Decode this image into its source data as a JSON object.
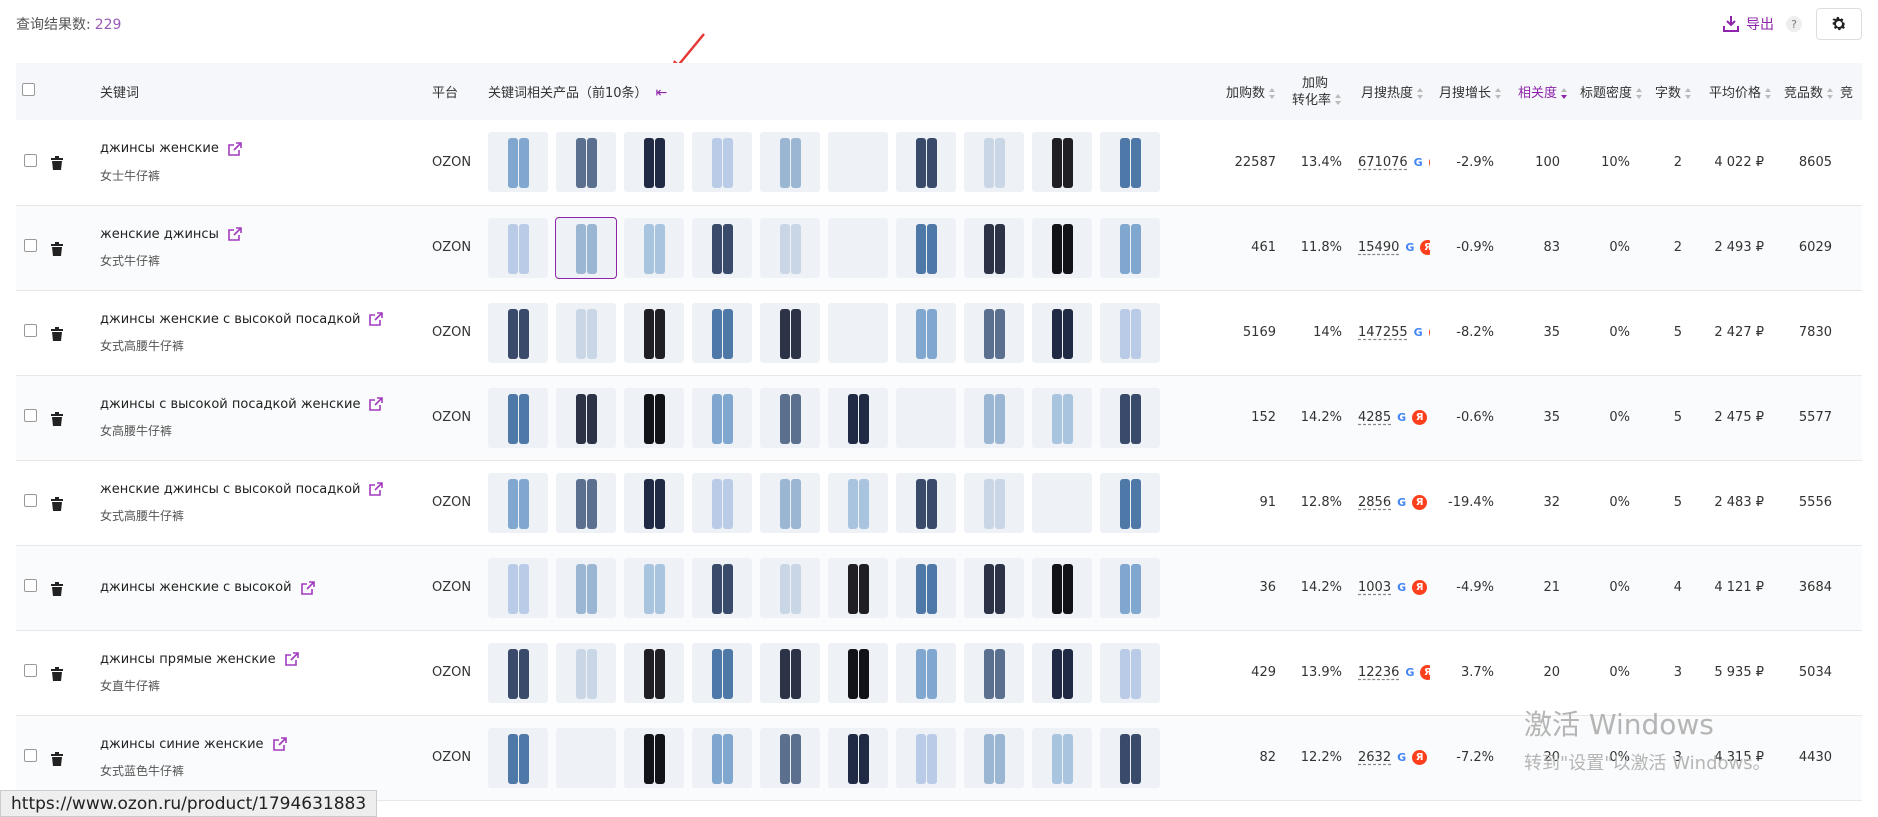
{
  "header": {
    "result_count_label": "查询结果数:",
    "result_count": "229",
    "export_label": "导出",
    "help": "?"
  },
  "columns": {
    "keyword": "关键词",
    "platform": "平台",
    "products": "关键词相关产品（前10条）",
    "cart_adds": "加购数",
    "cart_conv_line1": "加购",
    "cart_conv_line2": "转化率",
    "monthly_search": "月搜热度",
    "monthly_growth": "月搜增长",
    "relevance": "相关度",
    "title_density": "标题密度",
    "char_count": "字数",
    "avg_price": "平均价格",
    "competitors": "竞品数",
    "more": "竞"
  },
  "rows": [
    {
      "kw": "джинсы женские",
      "cn": "女士牛仔裤",
      "platform": "OZON",
      "cart": "22587",
      "conv": "13.4%",
      "search": "671076",
      "growth": "-2.9%",
      "rel": "100",
      "density": "10%",
      "chars": "2",
      "price": "4 022 ₽",
      "comp": "8605"
    },
    {
      "kw": "женские джинсы",
      "cn": "女式牛仔裤",
      "platform": "OZON",
      "cart": "461",
      "conv": "11.8%",
      "search": "15490",
      "growth": "-0.9%",
      "rel": "83",
      "density": "0%",
      "chars": "2",
      "price": "2 493 ₽",
      "comp": "6029"
    },
    {
      "kw": "джинсы женские с высокой посадкой",
      "cn": "女式高腰牛仔裤",
      "platform": "OZON",
      "cart": "5169",
      "conv": "14%",
      "search": "147255",
      "growth": "-8.2%",
      "rel": "35",
      "density": "0%",
      "chars": "5",
      "price": "2 427 ₽",
      "comp": "7830"
    },
    {
      "kw": "джинсы с высокой посадкой женские",
      "cn": "女高腰牛仔裤",
      "platform": "OZON",
      "cart": "152",
      "conv": "14.2%",
      "search": "4285",
      "growth": "-0.6%",
      "rel": "35",
      "density": "0%",
      "chars": "5",
      "price": "2 475 ₽",
      "comp": "5577"
    },
    {
      "kw": "женские джинсы с высокой посадкой",
      "cn": "女式高腰牛仔裤",
      "platform": "OZON",
      "cart": "91",
      "conv": "12.8%",
      "search": "2856",
      "growth": "-19.4%",
      "rel": "32",
      "density": "0%",
      "chars": "5",
      "price": "2 483 ₽",
      "comp": "5556"
    },
    {
      "kw": "джинсы женские с высокой",
      "cn": "",
      "platform": "OZON",
      "cart": "36",
      "conv": "14.2%",
      "search": "1003",
      "growth": "-4.9%",
      "rel": "21",
      "density": "0%",
      "chars": "4",
      "price": "4 121 ₽",
      "comp": "3684"
    },
    {
      "kw": "джинсы прямые женские",
      "cn": "女直牛仔裤",
      "platform": "OZON",
      "cart": "429",
      "conv": "13.9%",
      "search": "12236",
      "growth": "3.7%",
      "rel": "20",
      "density": "0%",
      "chars": "3",
      "price": "5 935 ₽",
      "comp": "5034"
    },
    {
      "kw": "джинсы синие женские",
      "cn": "女式蓝色牛仔裤",
      "platform": "OZON",
      "cart": "82",
      "conv": "12.2%",
      "search": "2632",
      "growth": "-7.2%",
      "rel": "20",
      "density": "0%",
      "chars": "3",
      "price": "4 315 ₽",
      "comp": "4430"
    }
  ],
  "watermark": {
    "line1": "激活 Windows",
    "line2": "转到\"设置\"以激活 Windows。"
  },
  "statusbar": {
    "url": "https://www.ozon.ru/product/1794631883"
  },
  "colors": {
    "accent": "#8e24aa",
    "header_bg": "#f5f7fa"
  },
  "icons": [
    "export-icon",
    "settings-icon",
    "trash-icon",
    "external-link-icon",
    "google-icon",
    "yandex-icon",
    "collapse-icon"
  ]
}
